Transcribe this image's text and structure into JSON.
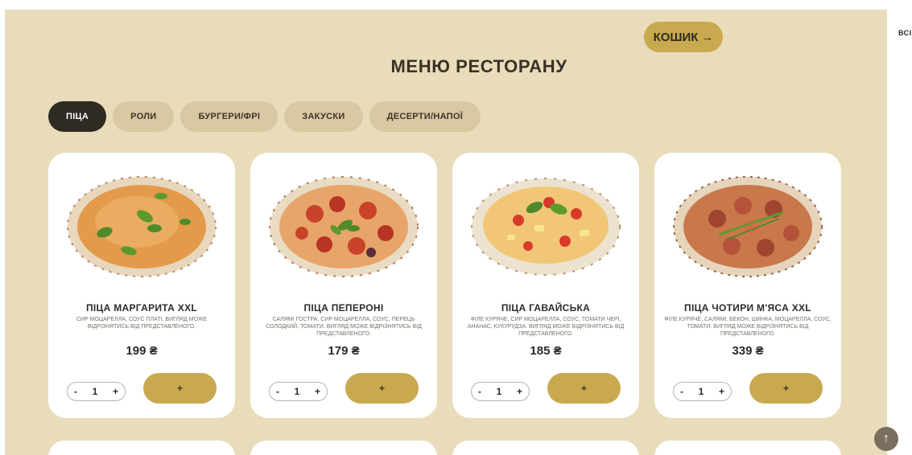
{
  "header": {
    "title": "МЕНЮ РЕСТОРАНУ",
    "cart_label": "КОШИК",
    "cart_arrow": "→"
  },
  "side": {
    "label": "ВСІ"
  },
  "tabs": [
    {
      "label": "ПІЦА",
      "active": true
    },
    {
      "label": "РОЛИ",
      "active": false
    },
    {
      "label": "БУРГЕРИ/ФРІ",
      "active": false
    },
    {
      "label": "ЗАКУСКИ",
      "active": false
    },
    {
      "label": "ДЕСЕРТИ/НАПОЇ",
      "active": false
    }
  ],
  "products": [
    {
      "name": "ПІЦА МАРГАРИТА XXL",
      "description": "СИР МОЦАРЕЛЛА, СОУС ПЛАТІ. ВИГЛЯД МОЖЕ ВІДРІЗНЯТИСЬ ВІД ПРЕДСТАВЛЕНОГО.",
      "price": "199 ₴",
      "qty_minus": "-",
      "qty_value": "1",
      "qty_plus": "+",
      "add_label": "+"
    },
    {
      "name": "ПІЦА ПЕПЕРОНІ",
      "description": "САЛЯМІ ГОСТРА, СИР МОЦАРЕЛЛА, СОУС, ПЕРЕЦЬ СОЛОДКИЙ, ТОМАТИ. ВИГЛЯД МОЖЕ ВІДРІЗНЯТИСЬ ВІД ПРЕДСТАВЛЕНОГО.",
      "price": "179 ₴",
      "qty_minus": "-",
      "qty_value": "1",
      "qty_plus": "+",
      "add_label": "+"
    },
    {
      "name": "ПІЦА ГАВАЙСЬКА",
      "description": "ФІЛЕ КУРЯЧЕ, СИР МОЦАРЕЛЛА, СОУС, ТОМАТИ ЧЕРІ, АНАНАС, КУКУРУДЗА. ВИГЛЯД МОЖЕ ВІДРІЗНЯТИСЬ ВІД ПРЕДСТАВЛЕНОГО.",
      "price": "185 ₴",
      "qty_minus": "-",
      "qty_value": "1",
      "qty_plus": "+",
      "add_label": "+"
    },
    {
      "name": "ПІЦА ЧОТИРИ М'ЯСА XXL",
      "description": "ФІЛЕ КУРЯЧЕ, САЛЯМІ, БЕКОН, ШИНКА, МОЦАРЕЛЛА, СОУС, ТОМАТИ. ВИГЛЯД МОЖЕ ВІДРІЗНЯТИСЬ ВІД ПРЕДСТАВЛЕНОГО.",
      "price": "339 ₴",
      "qty_minus": "-",
      "qty_value": "1",
      "qty_plus": "+",
      "add_label": "+"
    }
  ],
  "scroll_top": {
    "label": "↑"
  },
  "colors": {
    "background": "#e9dcbb",
    "accent": "#c9a94f",
    "active_tab": "#2f2a22",
    "tab": "#d8c9a3",
    "card": "#ffffff"
  }
}
